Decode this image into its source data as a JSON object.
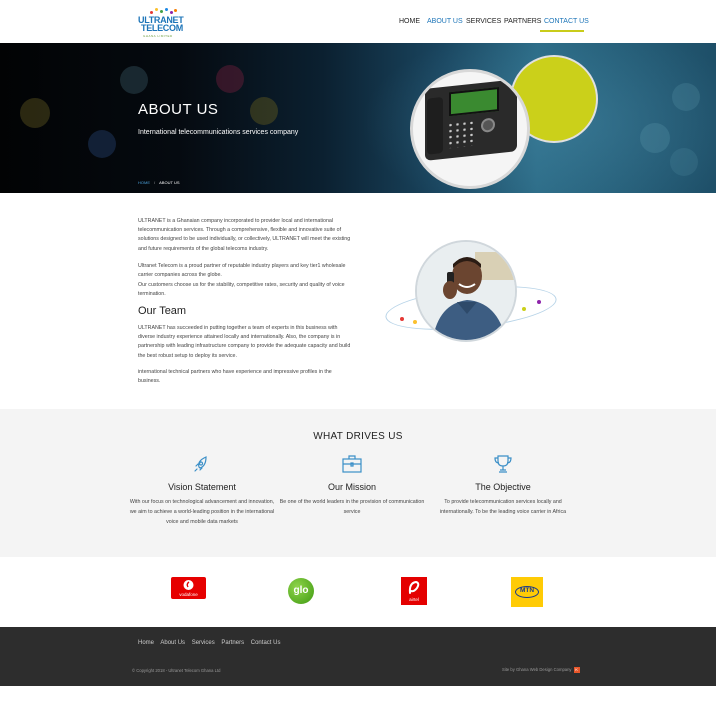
{
  "header": {
    "logo_line1": "ULTRANET",
    "logo_line2": "TELECOM",
    "logo_sub": "GHANA LIMITED",
    "nav": [
      "HOME",
      "ABOUT US",
      "SERVICES",
      "PARTNERS",
      "CONTACT US"
    ],
    "active_nav": [
      "ABOUT US",
      "CONTACT US"
    ]
  },
  "hero": {
    "title": "ABOUT US",
    "subtitle": "International telecommunications services company",
    "breadcrumb_home": "HOME",
    "breadcrumb_sep": "/",
    "breadcrumb_current": "ABOUT US"
  },
  "about": {
    "p1": "ULTRANET is a Ghanaian company incorporated to provider local and international telecommunication services. Through a comprehensive, flexible and innovative suite of solutions designed to be used individually, or collectively, ULTRANET will meet the existing and future requirements of the global telecoms industry.",
    "p2": "Ultranet Telecom is a proud partner of reputable industry players and key tier1 wholesale carrier companies across the globe.",
    "p3": "Our customers choose us for the stability, competitive rates, security and quality of voice termination.",
    "team_heading": "Our Team",
    "team_p": "ULTRANET has succeeded in putting together a team of experts in this business with diverse industry experience attained locally and internationally. Also, the company is in partnership with leading infrastructure company to provide the adequate capacity and build the best robust setup to deploy its service.",
    "team_p2": "international technical partners who have experience and impressive profiles in the business."
  },
  "drives": {
    "title": "WHAT DRIVES US",
    "items": [
      {
        "icon": "rocket-icon",
        "heading": "Vision Statement",
        "text": "With our focus on technological advancement and innovation, we aim to achieve a world-leading position in the international voice and mobile data markets"
      },
      {
        "icon": "briefcase-icon",
        "heading": "Our Mission",
        "text": "Be one of the world leaders in the provision of communication service"
      },
      {
        "icon": "trophy-icon",
        "heading": "The Objective",
        "text": "To provide telecommunication services locally and internationally. To be the leading voice carrier in Africa"
      }
    ]
  },
  "partners": {
    "vodafone": "vodafone",
    "glo": "glo",
    "airtel": "airtel",
    "mtn": "MTN"
  },
  "footer": {
    "links": [
      "Home",
      "About Us",
      "Services",
      "Partners",
      "Contact Us"
    ],
    "copyright": "© Copyright 2018 - Ultranet Telecom Ghana Ltd",
    "credit": "Site by Ghana Web Design Company"
  },
  "colors": {
    "brand_blue": "#1d75b8",
    "accent_yellow": "#c9cc1a",
    "footer_bg": "#2d2d2d",
    "vodafone_red": "#e60000",
    "glo_green": "#4caf1a",
    "airtel_red": "#e40000",
    "mtn_yellow": "#ffcb05"
  }
}
